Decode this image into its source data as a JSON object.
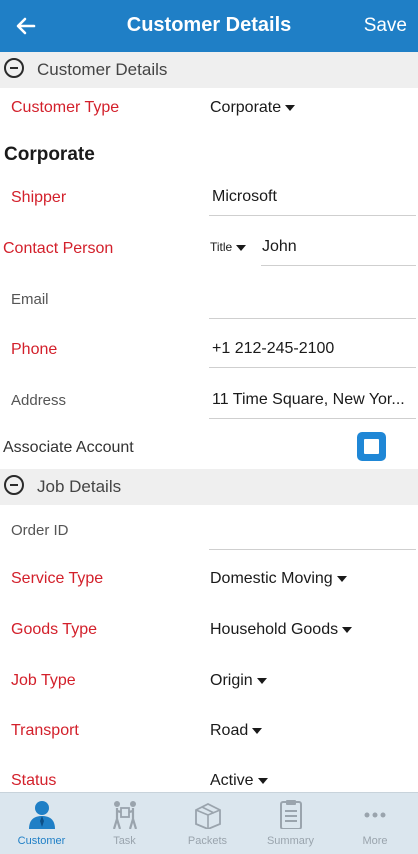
{
  "header": {
    "title": "Customer Details",
    "save_label": "Save",
    "back_icon": "arrow-left-icon"
  },
  "sections": {
    "customer": {
      "title": "Customer Details"
    },
    "job": {
      "title": "Job Details"
    }
  },
  "customer": {
    "customer_type_label": "Customer Type",
    "customer_type_value": "Corporate",
    "group_heading": "Corporate",
    "shipper_label": "Shipper",
    "shipper_value": "Microsoft",
    "contact_label": "Contact Person",
    "contact_title": "Title",
    "contact_name": "John",
    "email_label": "Email",
    "email_value": "",
    "phone_label": "Phone",
    "phone_value": "+1 212-245-2100",
    "address_label": "Address",
    "address_value": "11 Time Square, New Yor...",
    "associate_label": "Associate Account"
  },
  "job": {
    "order_label": "Order ID",
    "order_value": "",
    "service_label": "Service Type",
    "service_value": "Domestic Moving",
    "goods_label": "Goods Type",
    "goods_value": "Household Goods",
    "jobtype_label": "Job Type",
    "jobtype_value": "Origin",
    "transport_label": "Transport",
    "transport_value": "Road",
    "status_label": "Status",
    "status_value": "Active"
  },
  "tabs": [
    {
      "label": "Customer",
      "icon": "person-icon",
      "active": true
    },
    {
      "label": "Task",
      "icon": "movers-icon",
      "active": false
    },
    {
      "label": "Packets",
      "icon": "box-icon",
      "active": false
    },
    {
      "label": "Summary",
      "icon": "clipboard-icon",
      "active": false
    },
    {
      "label": "More",
      "icon": "more-dots-icon",
      "active": false
    }
  ],
  "colors": {
    "accent": "#1f7fc6",
    "required_label": "#d3202b",
    "section_bg": "#efefef",
    "tabbar_bg": "#dbe6ee"
  }
}
